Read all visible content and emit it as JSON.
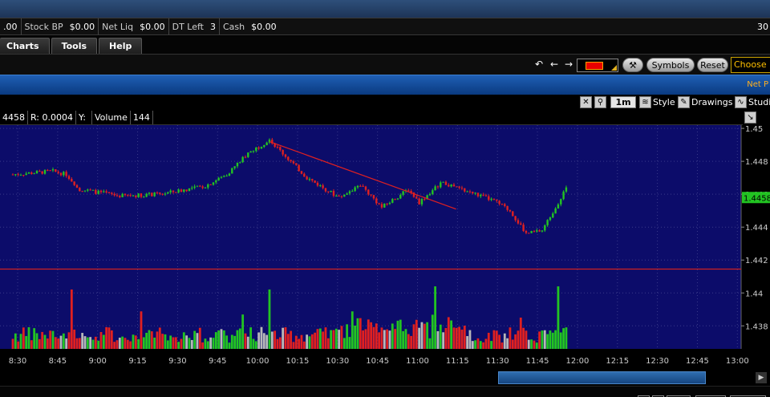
{
  "account": {
    "items": [
      {
        "label": "",
        "value": ".00"
      },
      {
        "label": "Stock BP",
        "value": "$0.00"
      },
      {
        "label": "Net Liq",
        "value": "$0.00"
      },
      {
        "label": "DT Left",
        "value": "3"
      },
      {
        "label": "Cash",
        "value": "$0.00"
      }
    ],
    "right_value": "30"
  },
  "tabs": [
    "Charts",
    "Tools",
    "Help"
  ],
  "toolbar": {
    "symbols_label": "Symbols",
    "reset_label": "Reset",
    "choose_label": "Choose P",
    "swatch_color": "#e80000"
  },
  "bluebar": {
    "right_label": "Net P"
  },
  "chart_tools": {
    "timeframe": "1m",
    "style_label": "Style",
    "drawings_label": "Drawings",
    "studies_label": "Studi"
  },
  "infobar": {
    "price": "4458",
    "r_label": "R: 0.0004",
    "y_label": "Y:",
    "volume_label": "Volume",
    "volume_value": "144"
  },
  "colors": {
    "plot_bg": "#0c0c6a",
    "up": "#22c422",
    "down": "#e02020",
    "neutral": "#b8b8b8",
    "trendline": "#e02020",
    "hline": "#d02020",
    "price_tag": "#22c422"
  },
  "chart_data": {
    "type": "candlestick",
    "title": "",
    "xlabel": "",
    "ylabel": "",
    "x_ticks": [
      "8:30",
      "8:45",
      "9:00",
      "9:15",
      "9:30",
      "9:45",
      "10:00",
      "10:15",
      "10:30",
      "10:45",
      "11:00",
      "11:15",
      "11:30",
      "11:45",
      "12:00",
      "12:15",
      "12:30",
      "12:45",
      "13:00"
    ],
    "y_ticks": [
      "1.45",
      "1.448",
      "1.446",
      "1.444",
      "1.442",
      "1.44",
      "1.438"
    ],
    "ylim": [
      1.4366,
      1.4502
    ],
    "last_price": "1.4458",
    "price_path": [
      {
        "t": 0,
        "p": 1.4472
      },
      {
        "t": 15,
        "p": 1.4474
      },
      {
        "t": 20,
        "p": 1.4472
      },
      {
        "t": 25,
        "p": 1.4463
      },
      {
        "t": 40,
        "p": 1.4459
      },
      {
        "t": 55,
        "p": 1.446
      },
      {
        "t": 72,
        "p": 1.4465
      },
      {
        "t": 80,
        "p": 1.4472
      },
      {
        "t": 88,
        "p": 1.4485
      },
      {
        "t": 96,
        "p": 1.4493
      },
      {
        "t": 110,
        "p": 1.447
      },
      {
        "t": 122,
        "p": 1.4458
      },
      {
        "t": 130,
        "p": 1.4466
      },
      {
        "t": 138,
        "p": 1.4452
      },
      {
        "t": 148,
        "p": 1.4463
      },
      {
        "t": 152,
        "p": 1.4455
      },
      {
        "t": 160,
        "p": 1.4467
      },
      {
        "t": 168,
        "p": 1.4463
      },
      {
        "t": 180,
        "p": 1.4456
      },
      {
        "t": 186,
        "p": 1.445
      },
      {
        "t": 192,
        "p": 1.4436
      },
      {
        "t": 198,
        "p": 1.4438
      },
      {
        "t": 204,
        "p": 1.4455
      },
      {
        "t": 207,
        "p": 1.4464
      }
    ],
    "volume_spikes": [
      {
        "t": 22,
        "v": 0.95
      },
      {
        "t": 48,
        "v": 0.6
      },
      {
        "t": 86,
        "v": 0.55
      },
      {
        "t": 96,
        "v": 0.95
      },
      {
        "t": 127,
        "v": 0.6
      },
      {
        "t": 158,
        "v": 1.0
      },
      {
        "t": 190,
        "v": 0.5
      },
      {
        "t": 204,
        "v": 1.0
      }
    ],
    "trendline": {
      "t1": 96,
      "p1": 1.4492,
      "t2": 152,
      "p2": 1.445
    },
    "hline": {
      "p": 1.44145
    }
  }
}
